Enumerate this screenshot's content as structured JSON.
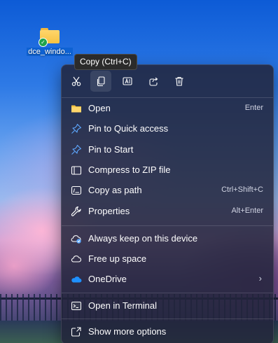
{
  "desktop": {
    "icon_label": "dce_windo..."
  },
  "tooltip": {
    "text": "Copy (Ctrl+C)"
  },
  "toolbar": {
    "buttons": [
      {
        "name": "cut",
        "icon": "scissors-icon"
      },
      {
        "name": "copy",
        "icon": "copy-icon",
        "active": true
      },
      {
        "name": "rename",
        "icon": "rename-icon"
      },
      {
        "name": "share",
        "icon": "share-icon"
      },
      {
        "name": "delete",
        "icon": "trash-icon"
      }
    ]
  },
  "menu": {
    "items": [
      {
        "label": "Open",
        "shortcut": "Enter",
        "icon": "folder-icon"
      },
      {
        "label": "Pin to Quick access",
        "shortcut": "",
        "icon": "pin-icon"
      },
      {
        "label": "Pin to Start",
        "shortcut": "",
        "icon": "pin-icon"
      },
      {
        "label": "Compress to ZIP file",
        "shortcut": "",
        "icon": "zip-icon"
      },
      {
        "label": "Copy as path",
        "shortcut": "Ctrl+Shift+C",
        "icon": "path-icon"
      },
      {
        "label": "Properties",
        "shortcut": "Alt+Enter",
        "icon": "wrench-icon"
      },
      {
        "label": "Always keep on this device",
        "shortcut": "",
        "icon": "cloud-keep-icon"
      },
      {
        "label": "Free up space",
        "shortcut": "",
        "icon": "cloud-icon"
      },
      {
        "label": "OneDrive",
        "shortcut": "",
        "icon": "onedrive-icon",
        "submenu": "›"
      },
      {
        "label": "Open in Terminal",
        "shortcut": "",
        "icon": "terminal-icon"
      },
      {
        "label": "Show more options",
        "shortcut": "",
        "icon": "more-options-icon"
      }
    ]
  },
  "colors": {
    "menu_bg": "#22243a",
    "folder_yellow": "#f6c343",
    "onedrive_blue": "#1e90ff",
    "accent_blue": "#5ea8ff"
  }
}
